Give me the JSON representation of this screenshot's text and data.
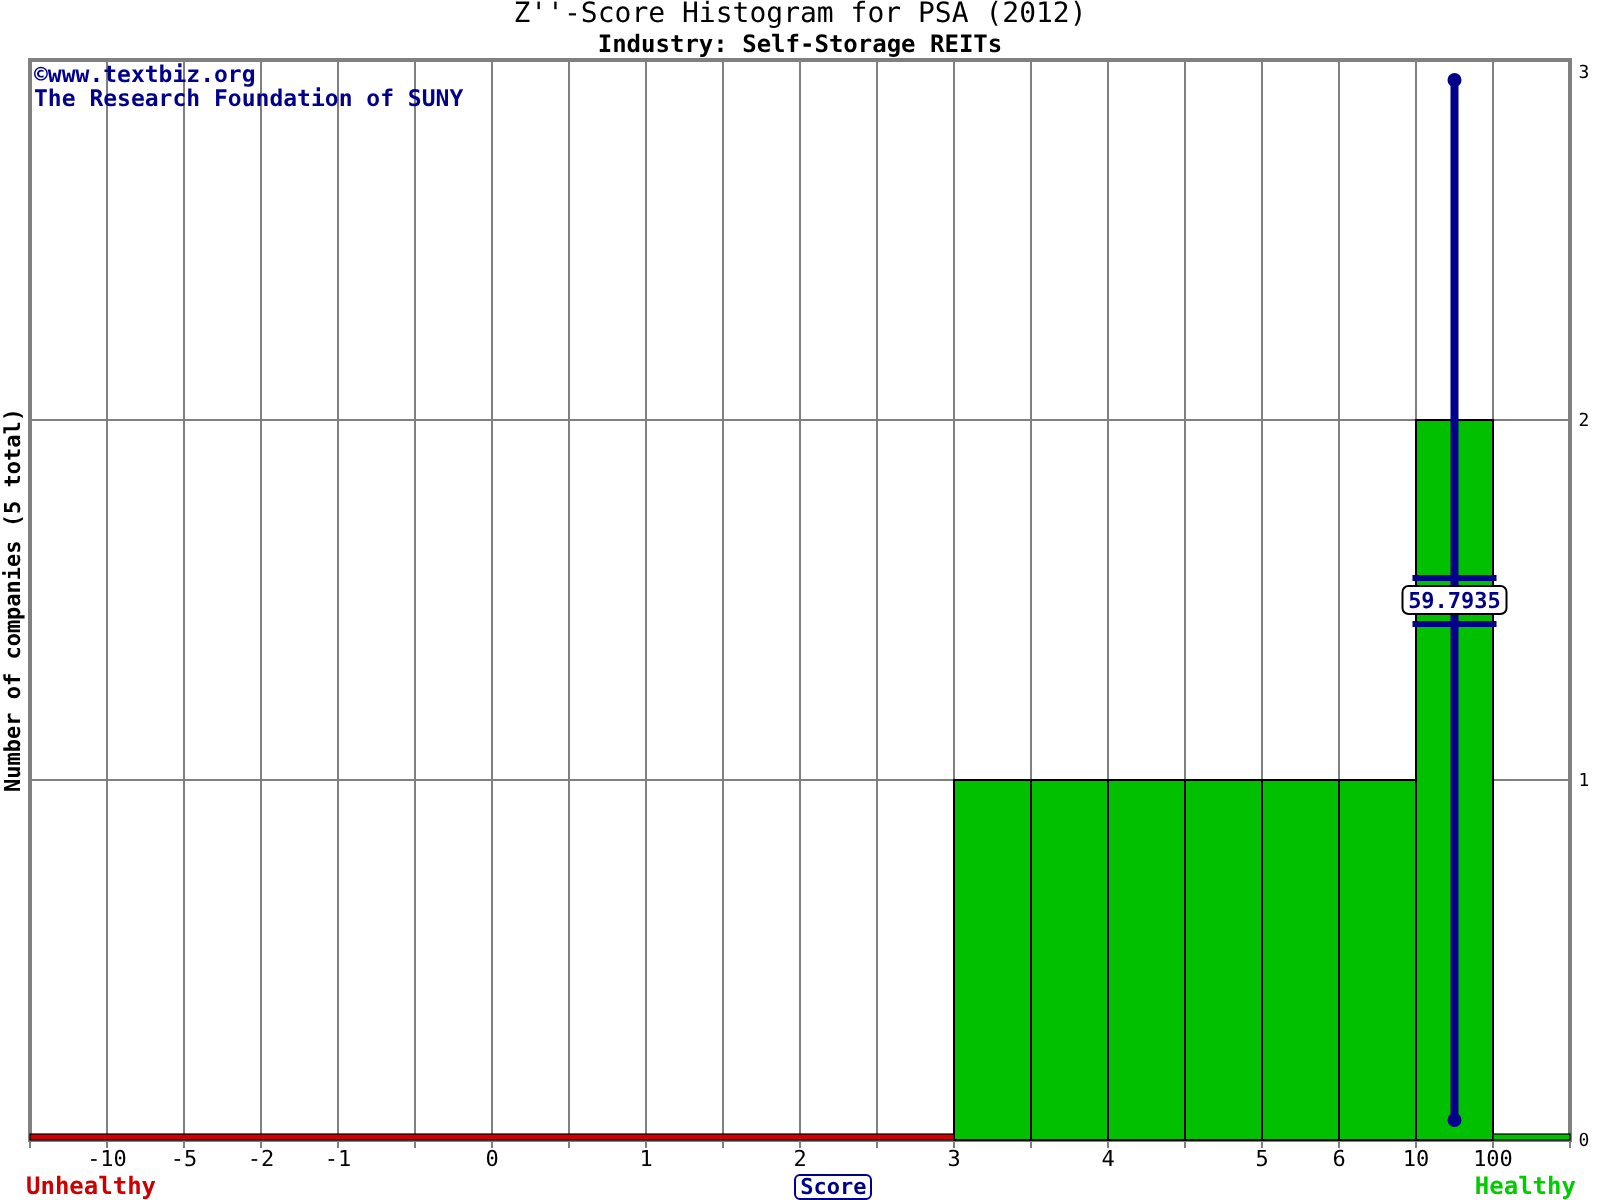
{
  "title": "Z''-Score Histogram for PSA (2012)",
  "subtitle": "Industry: Self-Storage REITs",
  "copyright": [
    "©www.textbiz.org",
    "The Research Foundation of SUNY"
  ],
  "chart_data": {
    "type": "bar",
    "ylabel": "Number of companies (5 total)",
    "xlabel": "Score",
    "ylim": [
      0,
      3
    ],
    "grid": true,
    "yticks": [
      0,
      1,
      2,
      3
    ],
    "categories": [
      null,
      "-10",
      "-5",
      "-2",
      "-1",
      null,
      "0",
      null,
      "1",
      null,
      "2",
      null,
      "3",
      null,
      "4",
      null,
      "5",
      "6",
      "10",
      "100"
    ],
    "series": [
      {
        "color": "#00c000",
        "values": [
          0,
          0,
          0,
          0,
          0,
          0,
          0,
          0,
          0,
          0,
          0,
          0,
          1,
          1,
          1,
          1,
          1,
          1,
          2,
          0
        ]
      }
    ],
    "annotations": [
      "59.7935"
    ]
  },
  "footer": {
    "left": "Unhealthy",
    "right": "Healthy"
  }
}
